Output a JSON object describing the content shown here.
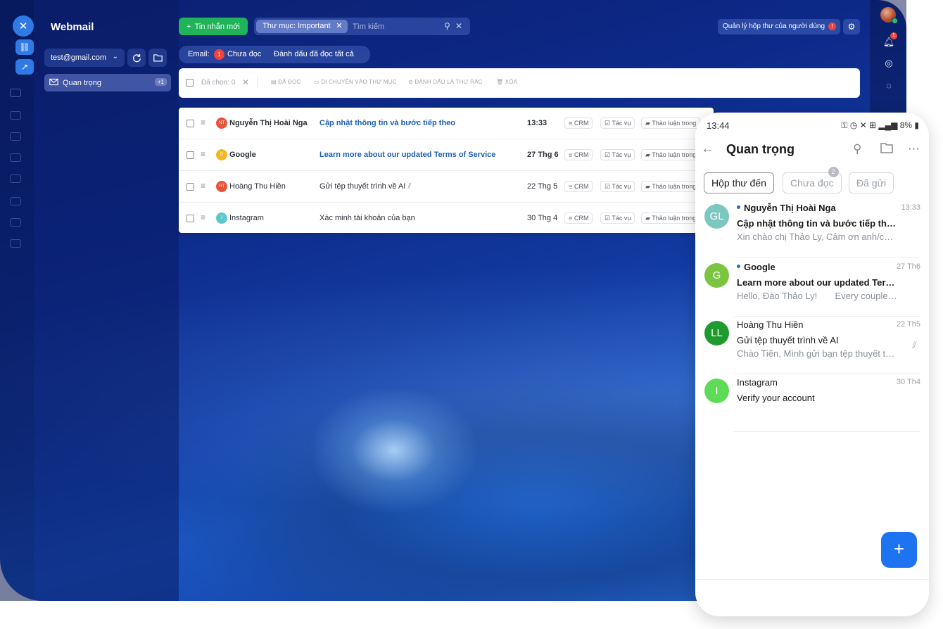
{
  "app": {
    "title": "Webmail",
    "account": "test@gmail.com",
    "new_message_label": "Tin nhắn mới",
    "manage_label": "Quản lý hộp thư của người dùng",
    "manage_badge": "!"
  },
  "sidebar": {
    "folders": [
      {
        "label": "Quan trọng",
        "count": "+1"
      }
    ]
  },
  "search": {
    "folder_chip": "Thư mục: Important",
    "placeholder": "Tìm kiếm"
  },
  "filter": {
    "email_label": "Email:",
    "unread_count": "1",
    "unread_label": "Chưa đọc",
    "mark_all_label": "Đánh dấu đã đọc tất cả"
  },
  "toolbar": {
    "selected_label": "Đã chọn: 0",
    "actions": [
      "ĐÃ ĐỌC",
      "DI CHUYỂN VÀO THƯ MỤC",
      "ĐÁNH DẤU LÀ THƯ RÁC",
      "XÓA"
    ]
  },
  "emails": [
    {
      "initials": "NT",
      "avatar_color": "#e8533c",
      "sender": "Nguyễn Thị Hoài Nga",
      "subject": "Cập nhật thông tin và bước tiếp theo",
      "date": "13:33",
      "unread": true,
      "tags": [
        "CRM",
        "Tác vụ",
        "Thảo luận trong"
      ]
    },
    {
      "initials": "G",
      "avatar_color": "#f2b824",
      "sender": "Google",
      "subject": "Learn more about our updated Terms of Service",
      "date": "27 Thg 6",
      "unread": true,
      "tags": [
        "CRM",
        "Tác vụ",
        "Thảo luận trong"
      ]
    },
    {
      "initials": "HT",
      "avatar_color": "#e8533c",
      "sender": "Hoàng Thu Hiền",
      "subject": "Gửi tệp thuyết trình về AI",
      "date": "22 Thg 5",
      "unread": false,
      "tags": [
        "CRM",
        "Tác vụ",
        "Thảo luận trong"
      ]
    },
    {
      "initials": "I",
      "avatar_color": "#5cc9c9",
      "sender": "Instagram",
      "subject": "Xác minh tài khoản của bạn",
      "date": "30 Thg 4",
      "unread": false,
      "tags": [
        "CRM",
        "Tác vụ",
        "Thảo luận trong"
      ]
    }
  ],
  "right_rail": {
    "notification_badge": "1"
  },
  "phone": {
    "time": "13:44",
    "battery": "8%",
    "title": "Quan trọng",
    "tabs": [
      {
        "label": "Hộp thư đến",
        "badge": ""
      },
      {
        "label": "Chưa đọc",
        "badge": "2"
      },
      {
        "label": "Đã gửi",
        "badge": ""
      }
    ],
    "messages": [
      {
        "initials": "GL",
        "avatar_color": "#7cc8c0",
        "sender": "Nguyễn Thị Hoài Nga",
        "date": "13:33",
        "subject": "Cập nhật thông tin và bước tiếp theo",
        "preview": "Xin chào chị Thảo Ly, Cảm ơn anh/chị đã dành thời gian",
        "unread": true
      },
      {
        "initials": "G",
        "avatar_color": "#7cc543",
        "sender": "Google",
        "date": "27 Th6",
        "subject": "Learn more about our updated Terms of Service",
        "preview": "Hello, Đào Thảo Ly!       Every couple of years",
        "unread": true
      },
      {
        "initials": "LL",
        "avatar_color": "#1f9a2f",
        "sender": "Hoàng Thu Hiền",
        "date": "22 Th5",
        "subject": "Gửi tệp thuyết trình về AI",
        "preview": "Chào Tiến, Mình gửi bạn tệp thuyết trình về AI",
        "unread": false
      },
      {
        "initials": "I",
        "avatar_color": "#5fdc57",
        "sender": "Instagram",
        "date": "30 Th4",
        "subject": "Verify your account",
        "preview": "",
        "unread": false
      }
    ]
  }
}
